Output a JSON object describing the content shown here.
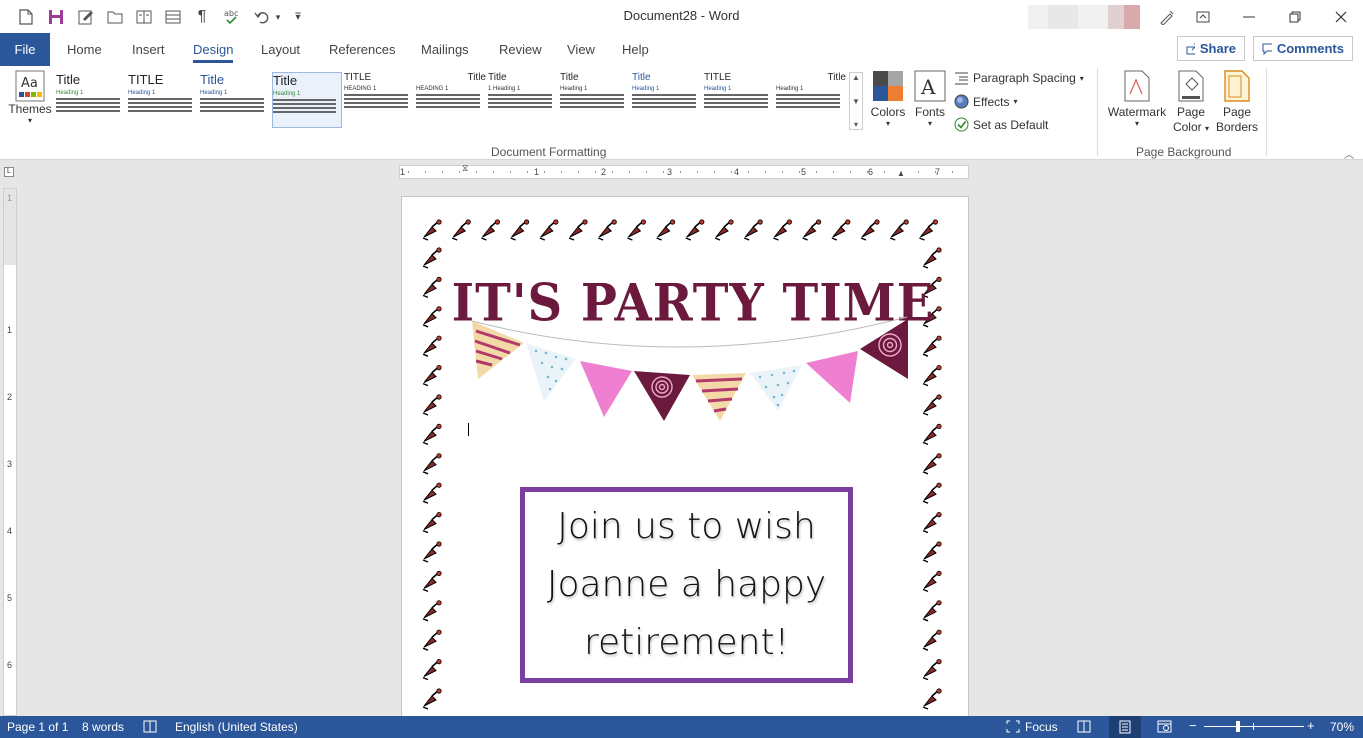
{
  "window": {
    "title": "Document28 - Word"
  },
  "quick_access": {
    "icons": [
      "new-document-icon",
      "save-icon",
      "edit-icon",
      "open-folder-icon",
      "book-icon",
      "layout-icon",
      "paragraph-mark-icon",
      "spelling-icon",
      "undo-icon",
      "customize-icon"
    ]
  },
  "tabs": [
    "Home",
    "Insert",
    "Design",
    "Layout",
    "References",
    "Mailings",
    "Review",
    "View",
    "Help"
  ],
  "file_tab": "File",
  "active_tab": "Design",
  "share_label": "Share",
  "comments_label": "Comments",
  "ribbon": {
    "themes_label": "Themes",
    "style_set": [
      {
        "title": "Title",
        "heading": "Heading 1"
      },
      {
        "title": "TITLE",
        "heading": "Heading 1"
      },
      {
        "title": "Title",
        "heading": "Heading 1"
      },
      {
        "title": "Title",
        "heading": "Heading 1"
      },
      {
        "title": "TITLE",
        "heading": "HEADING 1"
      },
      {
        "title": "Title",
        "heading": "HEADING 1"
      },
      {
        "title": "Title",
        "heading": "1 Heading 1"
      },
      {
        "title": "Title",
        "heading": "Heading 1"
      },
      {
        "title": "Title",
        "heading": "Heading 1"
      },
      {
        "title": "TITLE",
        "heading": "Heading 1"
      },
      {
        "title": "Title",
        "heading": "Heading 1"
      }
    ],
    "colors_label": "Colors",
    "fonts_label": "Fonts",
    "paragraph_spacing_label": "Paragraph Spacing",
    "effects_label": "Effects",
    "set_default_label": "Set as Default",
    "document_formatting_label": "Document Formatting",
    "watermark_label": "Watermark",
    "page_color_line1": "Page",
    "page_color_line2": "Color",
    "page_borders_line1": "Page",
    "page_borders_line2": "Borders",
    "page_background_label": "Page Background"
  },
  "ruler": {
    "h_numbers": [
      "1",
      "1",
      "2",
      "3",
      "4",
      "5",
      "6",
      "7"
    ],
    "v_numbers": [
      "1",
      "1",
      "2",
      "3",
      "4",
      "5",
      "6"
    ]
  },
  "document": {
    "heading": "IT'S PARTY TIME",
    "message_lines": [
      "Join us to wish",
      "Joanne a happy",
      "retirement!"
    ],
    "border_color": "#7b3fa0",
    "heading_color": "#6b1a3d"
  },
  "status": {
    "page": "Page 1 of 1",
    "words": "8 words",
    "language": "English (United States)",
    "focus": "Focus",
    "zoom": "70%"
  },
  "colors": {
    "accent": "#2b579a"
  }
}
